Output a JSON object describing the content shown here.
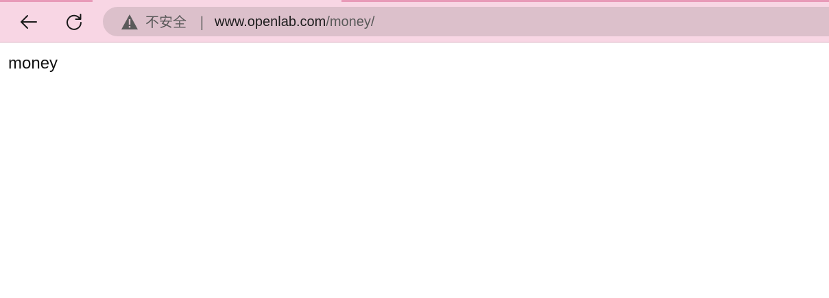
{
  "browser": {
    "security_label": "不安全",
    "separator": "|",
    "url_host": "www.openlab.com",
    "url_path": "/money/",
    "icons": {
      "back": "back-arrow-icon",
      "reload": "reload-icon",
      "warning": "warning-triangle-icon"
    },
    "colors": {
      "toolbar_bg": "#f8d6e4",
      "address_bar_bg": "#dcc0cb",
      "tab_accent": "#e89ab8"
    }
  },
  "page": {
    "body_text": "money"
  }
}
